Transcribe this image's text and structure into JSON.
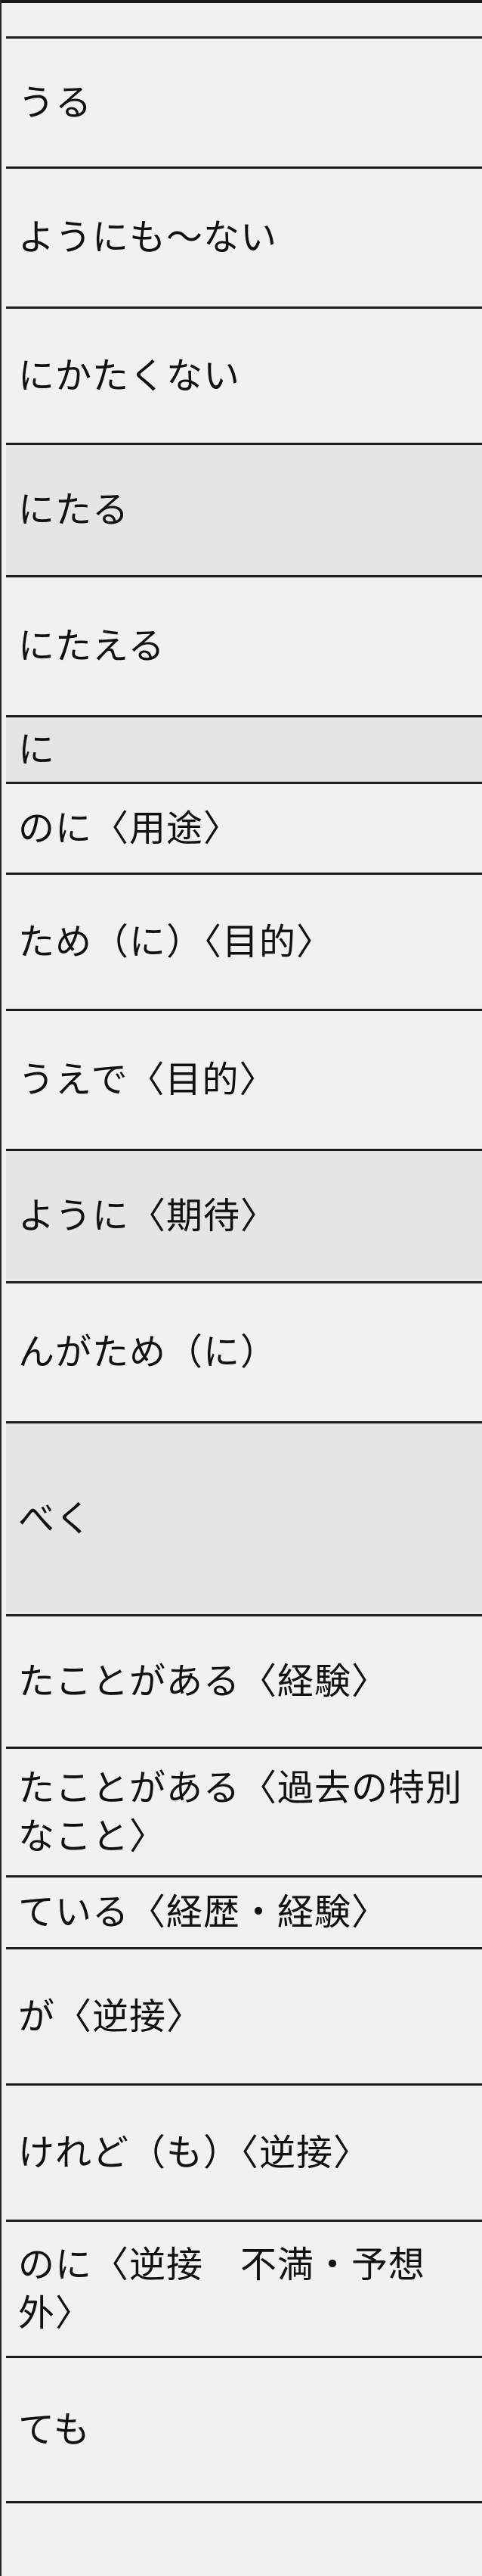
{
  "rows": [
    {
      "text": "うる"
    },
    {
      "text": "ようにも〜ない"
    },
    {
      "text": "にかたくない"
    },
    {
      "text": "にたる"
    },
    {
      "text": "にたえる"
    },
    {
      "text": "に"
    },
    {
      "text": "のに〈用途〉"
    },
    {
      "text": "ため（に）〈目的〉"
    },
    {
      "text": "うえで〈目的〉"
    },
    {
      "text": "ように〈期待〉"
    },
    {
      "text": "んがため（に）"
    },
    {
      "text": "べく"
    },
    {
      "text": "たことがある〈経験〉"
    },
    {
      "text": "たことがある〈過去の特別なこと〉"
    },
    {
      "text": "ている〈経歴・経験〉"
    },
    {
      "text": "が〈逆接〉"
    },
    {
      "text": "けれど（も）〈逆接〉"
    },
    {
      "text": "のに〈逆接　不満・予想外〉"
    },
    {
      "text": "ても"
    }
  ]
}
